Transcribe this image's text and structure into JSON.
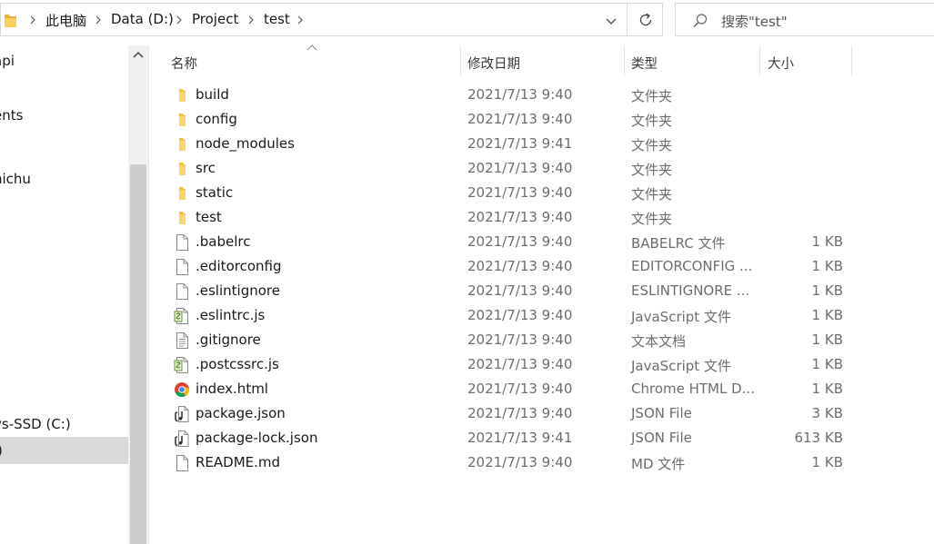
{
  "addressbar": {
    "crumbs": [
      "此电脑",
      "Data (D:)",
      "Project",
      "test"
    ]
  },
  "search": {
    "placeholder": "搜索\"test\""
  },
  "nav": {
    "items": [
      "api",
      "ents",
      "nichu",
      "vs-SSD (C:)",
      ")"
    ]
  },
  "columns": {
    "name": "名称",
    "date": "修改日期",
    "type": "类型",
    "size": "大小"
  },
  "files": [
    {
      "name": "build",
      "date": "2021/7/13 9:40",
      "type": "文件夹",
      "size": "",
      "icon": "folder-icon"
    },
    {
      "name": "config",
      "date": "2021/7/13 9:40",
      "type": "文件夹",
      "size": "",
      "icon": "folder-icon"
    },
    {
      "name": "node_modules",
      "date": "2021/7/13 9:41",
      "type": "文件夹",
      "size": "",
      "icon": "folder-icon"
    },
    {
      "name": "src",
      "date": "2021/7/13 9:40",
      "type": "文件夹",
      "size": "",
      "icon": "folder-icon"
    },
    {
      "name": "static",
      "date": "2021/7/13 9:40",
      "type": "文件夹",
      "size": "",
      "icon": "folder-icon"
    },
    {
      "name": "test",
      "date": "2021/7/13 9:40",
      "type": "文件夹",
      "size": "",
      "icon": "folder-icon"
    },
    {
      "name": ".babelrc",
      "date": "2021/7/13 9:40",
      "type": "BABELRC 文件",
      "size": "1 KB",
      "icon": "blank-file-icon"
    },
    {
      "name": ".editorconfig",
      "date": "2021/7/13 9:40",
      "type": "EDITORCONFIG ...",
      "size": "1 KB",
      "icon": "blank-file-icon"
    },
    {
      "name": ".eslintignore",
      "date": "2021/7/13 9:40",
      "type": "ESLINTIGNORE ...",
      "size": "1 KB",
      "icon": "blank-file-icon"
    },
    {
      "name": ".eslintrc.js",
      "date": "2021/7/13 9:40",
      "type": "JavaScript 文件",
      "size": "1 KB",
      "icon": "script-file-icon"
    },
    {
      "name": ".gitignore",
      "date": "2021/7/13 9:40",
      "type": "文本文档",
      "size": "1 KB",
      "icon": "text-file-icon"
    },
    {
      "name": ".postcssrc.js",
      "date": "2021/7/13 9:40",
      "type": "JavaScript 文件",
      "size": "1 KB",
      "icon": "script-file-icon"
    },
    {
      "name": "index.html",
      "date": "2021/7/13 9:40",
      "type": "Chrome HTML D...",
      "size": "1 KB",
      "icon": "chrome-icon"
    },
    {
      "name": "package.json",
      "date": "2021/7/13 9:40",
      "type": "JSON File",
      "size": "3 KB",
      "icon": "json-file-icon"
    },
    {
      "name": "package-lock.json",
      "date": "2021/7/13 9:41",
      "type": "JSON File",
      "size": "613 KB",
      "icon": "json-file-icon"
    },
    {
      "name": "README.md",
      "date": "2021/7/13 9:40",
      "type": "MD 文件",
      "size": "1 KB",
      "icon": "blank-file-icon"
    }
  ],
  "colors": {
    "folder": "#f4c430",
    "selection": "#d9d9d9",
    "secondary_text": "#6d6d6d"
  }
}
